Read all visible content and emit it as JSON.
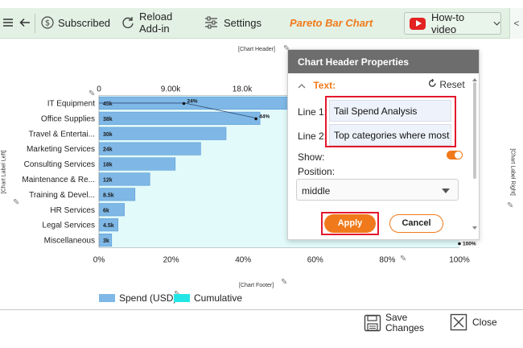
{
  "toolbar": {
    "subscribed_label": "Subscribed",
    "reload_label_1": "Reload",
    "reload_label_2": "Add-in",
    "settings_label": "Settings",
    "chart_name": "Pareto Bar Chart",
    "howto_label": "How-to video",
    "collapse_glyph": "<",
    "menu_icon": "hamburger-icon",
    "back_icon": "back-arrow-icon"
  },
  "chart_labels": {
    "header": "[Chart Header]",
    "footer": "[Chart Footer]",
    "label_left": "[Chart Label Left]",
    "label_right": "[Chart Label Right]"
  },
  "chart_data": {
    "type": "bar",
    "orientation": "horizontal",
    "categories": [
      "IT Equipment",
      "Office Supplies",
      "Travel & Entertai...",
      "Marketing Services",
      "Consulting Services",
      "Maintenance & Re...",
      "Training & Devel...",
      "HR Services",
      "Legal Services",
      "Miscellaneous"
    ],
    "series": [
      {
        "name": "Spend (USD)",
        "values": [
          45000,
          38000,
          30000,
          24000,
          18000,
          12000,
          8500,
          6000,
          4500,
          3000
        ],
        "labels": [
          "45k",
          "38k",
          "30k",
          "24k",
          "18k",
          "12k",
          "8.5k",
          "6k",
          "4.5k",
          "3k"
        ]
      },
      {
        "name": "Cumulative",
        "values": [
          24,
          44
        ],
        "labels": [
          "24%",
          "44%"
        ]
      }
    ],
    "top_axis_ticks": [
      "0",
      "9.00k",
      "18.0k"
    ],
    "bottom_axis_ticks": [
      "0%",
      "20%",
      "40%",
      "60%",
      "80%",
      "100%"
    ],
    "end_label": "100%",
    "xlim": [
      0,
      45000
    ],
    "colors": {
      "bar": "#7fb8e6",
      "bar_edge": "#5b9bd5",
      "cumulative_area": "#e2fafa",
      "cumulative_line": "#2c4a73",
      "legend_cumulative": "#22e6e6"
    }
  },
  "legend": {
    "spend_label": "Spend (USD)",
    "cumulative_label": "Cumulative"
  },
  "panel": {
    "title": "Chart Header Properties",
    "section_label": "Text:",
    "reset_label": "Reset",
    "line1_label": "Line 1:",
    "line1_value": "Tail Spend Analysis",
    "line2_label": "Line 2:",
    "line2_value": "Top categories where most of t",
    "show_label": "Show:",
    "show_enabled": true,
    "position_label": "Position:",
    "position_value": "middle",
    "apply_label": "Apply",
    "cancel_label": "Cancel",
    "accent_color": "#f07a1b",
    "highlight_color": "#e3182d"
  },
  "footer": {
    "save_label_1": "Save",
    "save_label_2": "Changes",
    "close_label": "Close"
  }
}
